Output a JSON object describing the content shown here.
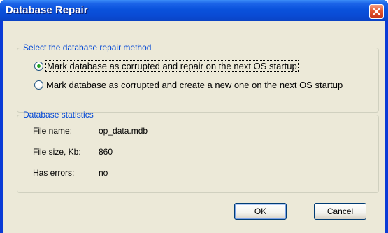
{
  "window": {
    "title": "Database Repair",
    "close_icon": "close-icon"
  },
  "repair_method": {
    "legend": "Select the database repair method",
    "options": [
      {
        "label": "Mark database as corrupted and repair on the next OS startup",
        "selected": true
      },
      {
        "label": "Mark database as corrupted and create a new one on the next OS startup",
        "selected": false
      }
    ]
  },
  "statistics": {
    "legend": "Database statistics",
    "rows": [
      {
        "label": "File name:",
        "value": "op_data.mdb"
      },
      {
        "label": "File size, Kb:",
        "value": "860"
      },
      {
        "label": "Has errors:",
        "value": "no"
      }
    ]
  },
  "buttons": {
    "ok_label": "OK",
    "cancel_label": "Cancel"
  },
  "colors": {
    "title_bar": "#0a52dc",
    "group_legend": "#0046d5",
    "dialog_background": "#ece9d8",
    "close_button": "#e4572f"
  }
}
